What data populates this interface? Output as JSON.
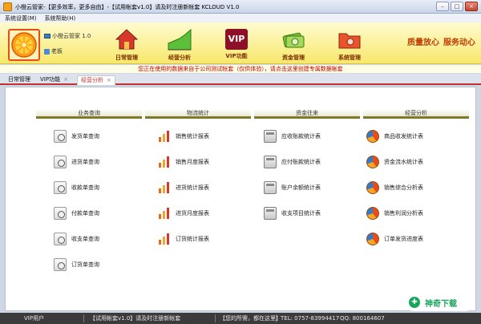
{
  "window": {
    "title": "小橙云管家-【更多效率，更多自由】-【试用帐套v1.0】请及时注册新帐套  KCLOUD V1.0",
    "controls": [
      "–",
      "□",
      "×"
    ]
  },
  "menu": {
    "items": [
      "系统设置(M)",
      "系统帮助(H)"
    ]
  },
  "header": {
    "brand": "小橙云管家 1.0",
    "user": "老板",
    "nav": [
      {
        "label": "日常管理",
        "icon": "house-icon"
      },
      {
        "label": "经营分析",
        "icon": "area-chart-icon"
      },
      {
        "label": "VIP功能",
        "icon": "vip-icon",
        "badge": "VIP"
      },
      {
        "label": "资金管理",
        "icon": "money-icon"
      },
      {
        "label": "系统管理",
        "icon": "folder-settings-icon"
      }
    ],
    "slogans": [
      "质量放心",
      "服务动心"
    ]
  },
  "notice": "您正在使用的数据来自于公司测试帐套（仅供体验），请点击这里创建专属数据帐套",
  "tabs": [
    {
      "label": "日常管理",
      "closable": false,
      "active": false
    },
    {
      "label": "VIP功能",
      "closable": true,
      "active": false
    },
    {
      "label": "经营分析",
      "closable": true,
      "active": true
    }
  ],
  "columns": [
    {
      "heading": "业务查询",
      "icon": "document-search-icon",
      "items": [
        "发货单查询",
        "进货单查询",
        "收款单查询",
        "付款单查询",
        "收支单查询",
        "订货单查询"
      ]
    },
    {
      "heading": "物流统计",
      "icon": "bar-chart-icon",
      "items": [
        "销售统计报表",
        "销售月度报表",
        "进货统计报表",
        "进货月度报表",
        "订货统计报表"
      ]
    },
    {
      "heading": "资金往来",
      "icon": "calculator-icon",
      "items": [
        "应收账款统计表",
        "应付账款统计表",
        "账户余额统计表",
        "收支项目统计表"
      ]
    },
    {
      "heading": "经营分析",
      "icon": "pie-chart-icon",
      "items": [
        "商品收发统计表",
        "资金流水统计表",
        "销售综合分析表",
        "销售利润分析表",
        "订单发货进度表"
      ]
    }
  ],
  "status": {
    "role": "VIP用户",
    "account": "【试用帐套v1.0】请及时注册新帐套",
    "tagline": "【您的所需，都在这里】",
    "tel": "TEL: 0757-83994417",
    "qq": "QQ: 800164607"
  },
  "watermark": {
    "symbol": "✚",
    "text": "神奇下载"
  },
  "colors": {
    "accent": "#c33030",
    "header": "#f7e86a",
    "section_rule": "#7f7a2a"
  }
}
